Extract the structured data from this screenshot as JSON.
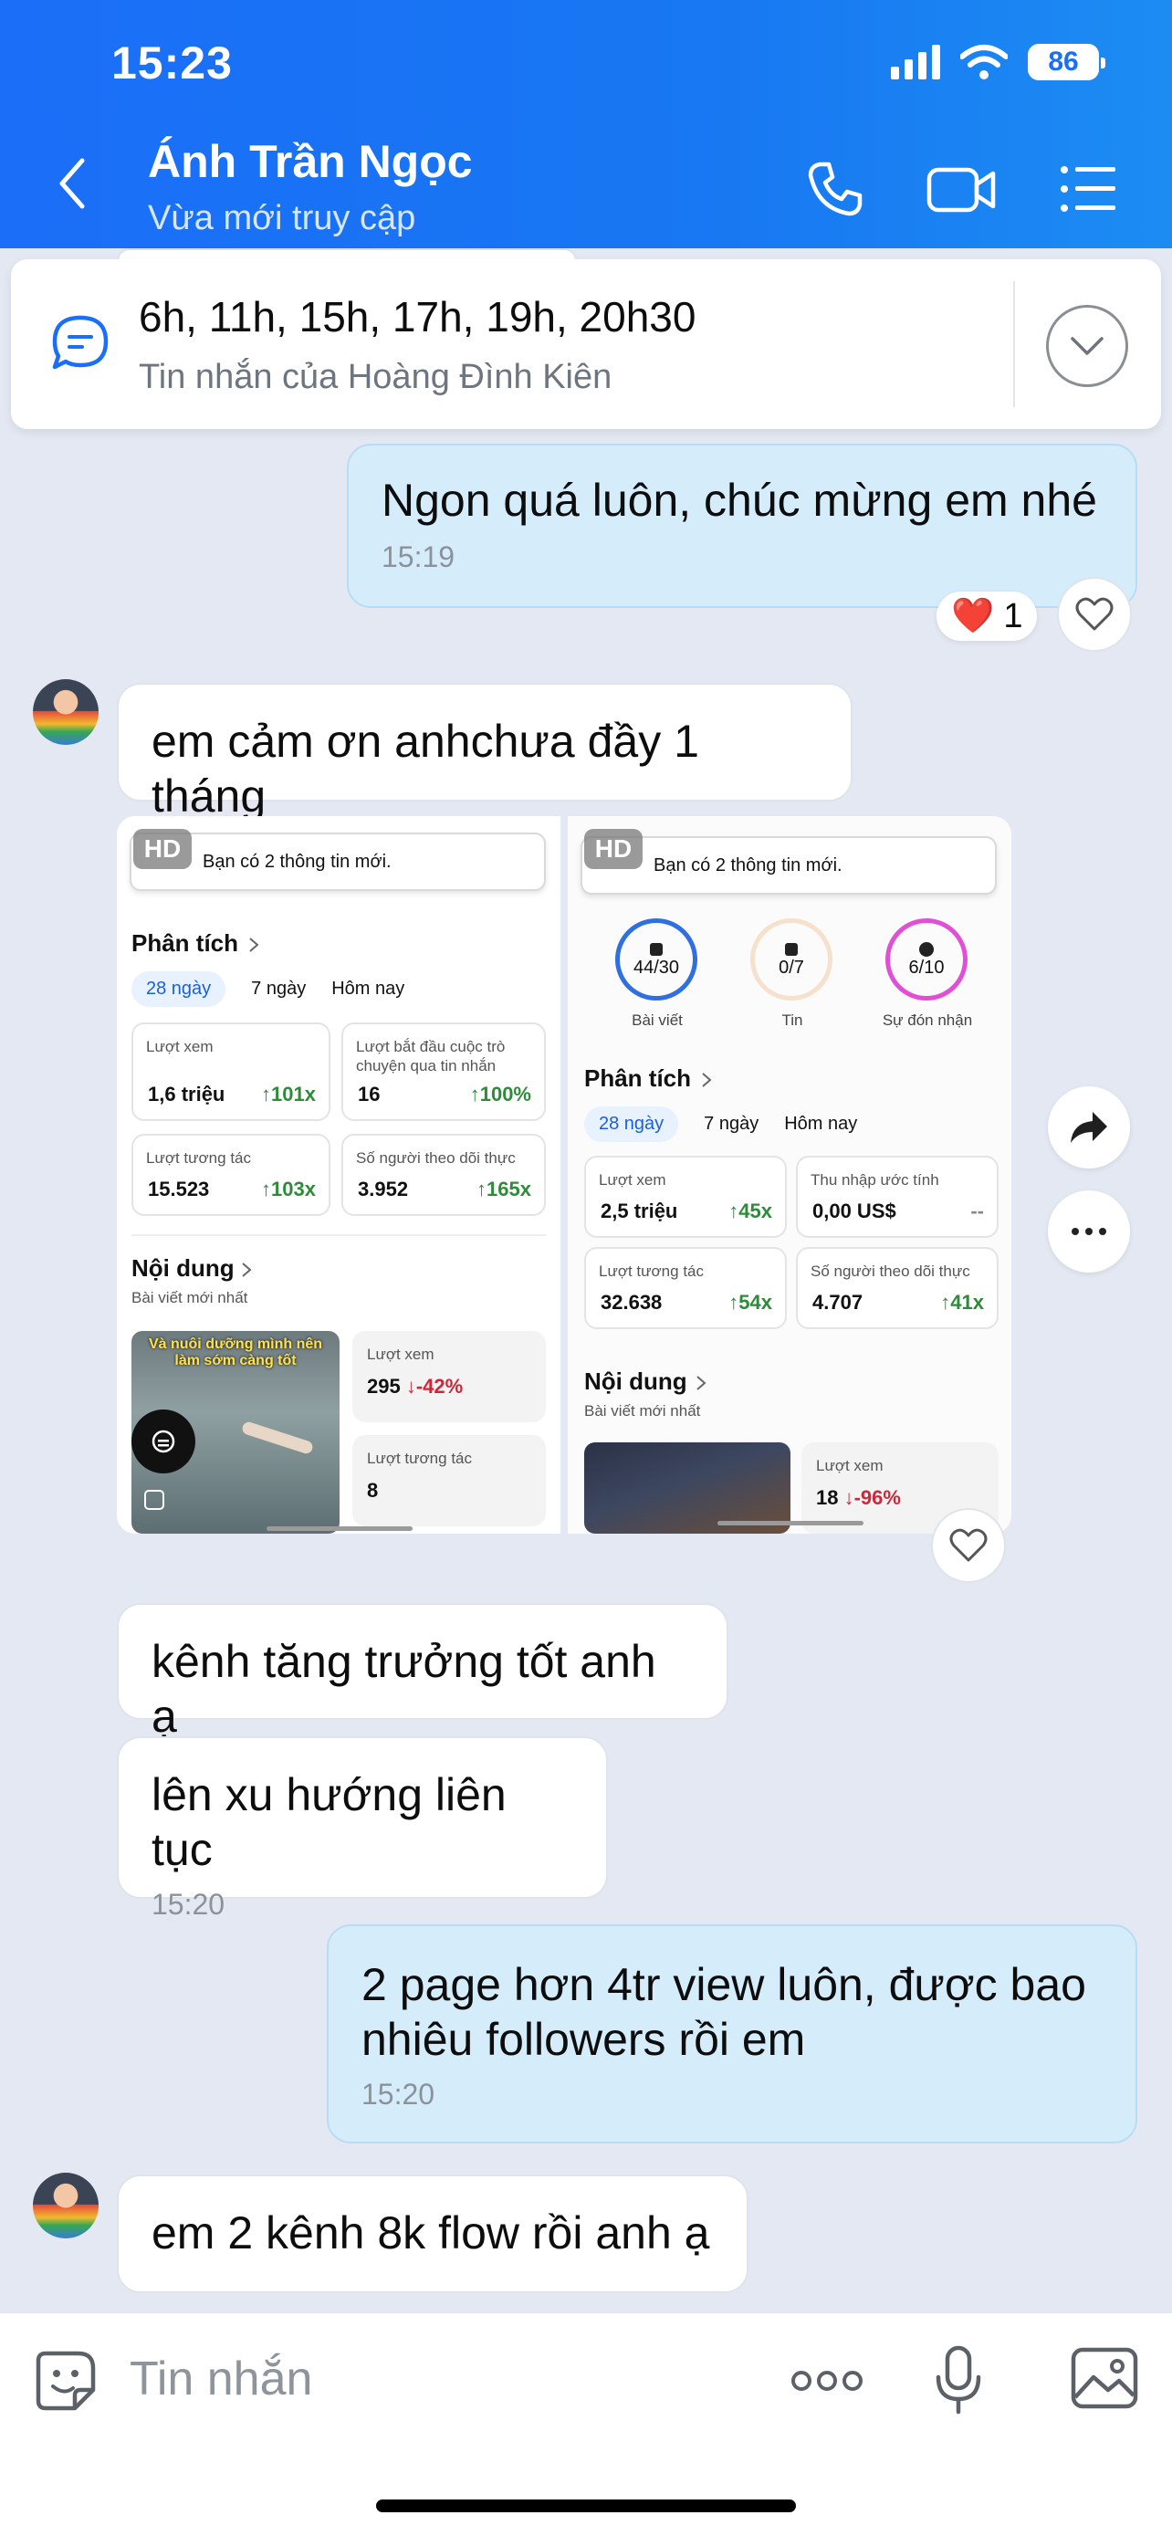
{
  "status": {
    "time": "15:23",
    "battery": "86"
  },
  "header": {
    "contact_name": "Ánh Trần Ngọc",
    "contact_status": "Vừa mới truy cập"
  },
  "pinned": {
    "title": "6h, 11h, 15h, 17h, 19h, 20h30",
    "subtitle": "Tin nhắn của Hoàng Đình Kiên"
  },
  "messages": [
    {
      "text": "Ngon quá luôn, chúc mừng em nhé",
      "time": "15:19",
      "reaction_emoji": "❤️",
      "reaction_count": "1"
    },
    {
      "text": "em cảm ơn anhchưa đầy 1 tháng"
    },
    {
      "text": "kênh tăng trưởng tốt anh ạ"
    },
    {
      "text": "lên xu hướng liên tục",
      "time": "15:20"
    },
    {
      "text": "2 page hơn 4tr view luôn, được bao nhiêu followers rồi em",
      "time": "15:20"
    },
    {
      "text": "em 2 kênh 8k flow rồi anh ạ"
    }
  ],
  "shot1": {
    "hd": "HD",
    "notif": "Bạn có 2 thông tin mới.",
    "section": "Phân tích",
    "tabs": [
      "28 ngày",
      "7 ngày",
      "Hôm nay"
    ],
    "cards": [
      {
        "label": "Lượt xem",
        "value": "1,6 triệu",
        "change": "↑101x"
      },
      {
        "label": "Lượt bắt đầu cuộc trò chuyện qua tin nhắn",
        "value": "16",
        "change": "↑100%"
      },
      {
        "label": "Lượt tương tác",
        "value": "15.523",
        "change": "↑103x"
      },
      {
        "label": "Số người theo dõi thực",
        "value": "3.952",
        "change": "↑165x"
      }
    ],
    "content_title": "Nội dung",
    "content_sub": "Bài viết mới nhất",
    "thumb_caption": "Và nuôi dưỡng mình nên làm sớm càng tốt",
    "mini": [
      {
        "label": "Lượt xem",
        "value": "295",
        "change": "↓-42%"
      },
      {
        "label": "Lượt tương tác",
        "value": "8"
      }
    ]
  },
  "shot2": {
    "hd": "HD",
    "notif": "Bạn có 2 thông tin mới.",
    "rings": [
      {
        "value": "44/30",
        "label": "Bài viết",
        "color": "#2f6fe0"
      },
      {
        "value": "0/7",
        "label": "Tin",
        "color": "#f1c59b"
      },
      {
        "value": "6/10",
        "label": "Sự đón nhận",
        "color": "#e04fd6"
      }
    ],
    "section": "Phân tích",
    "tabs": [
      "28 ngày",
      "7 ngày",
      "Hôm nay"
    ],
    "cards": [
      {
        "label": "Lượt xem",
        "value": "2,5 triệu",
        "change": "↑45x"
      },
      {
        "label": "Thu nhập ước tính",
        "value": "0,00 US$",
        "change": "--"
      },
      {
        "label": "Lượt tương tác",
        "value": "32.638",
        "change": "↑54x"
      },
      {
        "label": "Số người theo dõi thực",
        "value": "4.707",
        "change": "↑41x"
      }
    ],
    "content_title": "Nội dung",
    "content_sub": "Bài viết mới nhất",
    "mini": [
      {
        "label": "Lượt xem",
        "value": "18",
        "change": "↓-96%"
      }
    ]
  },
  "input": {
    "placeholder": "Tin nhắn"
  },
  "colors": {
    "header_blue": "#1a6ef7",
    "outgoing_bubble": "#d5ecfb",
    "incoming_bubble": "#ffffff",
    "background": "#e3e8f2"
  }
}
